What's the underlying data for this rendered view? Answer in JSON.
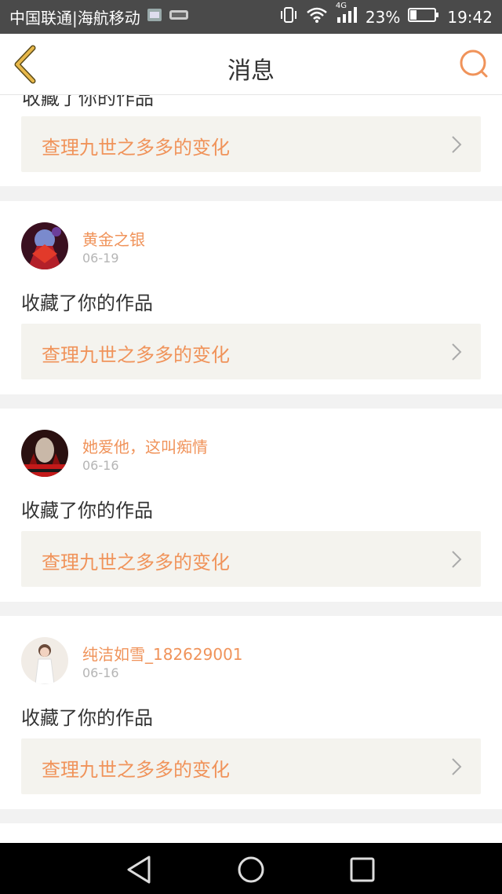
{
  "status_bar": {
    "carrier": "中国联通|海航移动",
    "network": "4G",
    "battery": "23%",
    "time": "19:42"
  },
  "header": {
    "title": "消息"
  },
  "top_card": {
    "partial_action": "收藏了你的作品",
    "link": "查理九世之多多的变化"
  },
  "messages": [
    {
      "username": "黄金之银",
      "date": "06-19",
      "action": "收藏了你的作品",
      "link": "查理九世之多多的变化"
    },
    {
      "username": "她爱他，这叫痴情",
      "date": "06-16",
      "action": "收藏了你的作品",
      "link": "查理九世之多多的变化"
    },
    {
      "username": "纯洁如雪_182629001",
      "date": "06-16",
      "action": "收藏了你的作品",
      "link": "查理九世之多多的变化"
    }
  ],
  "colors": {
    "accent": "#f0935a",
    "back_icon": "#e8b84a",
    "link_bg": "#f4f3ee"
  }
}
